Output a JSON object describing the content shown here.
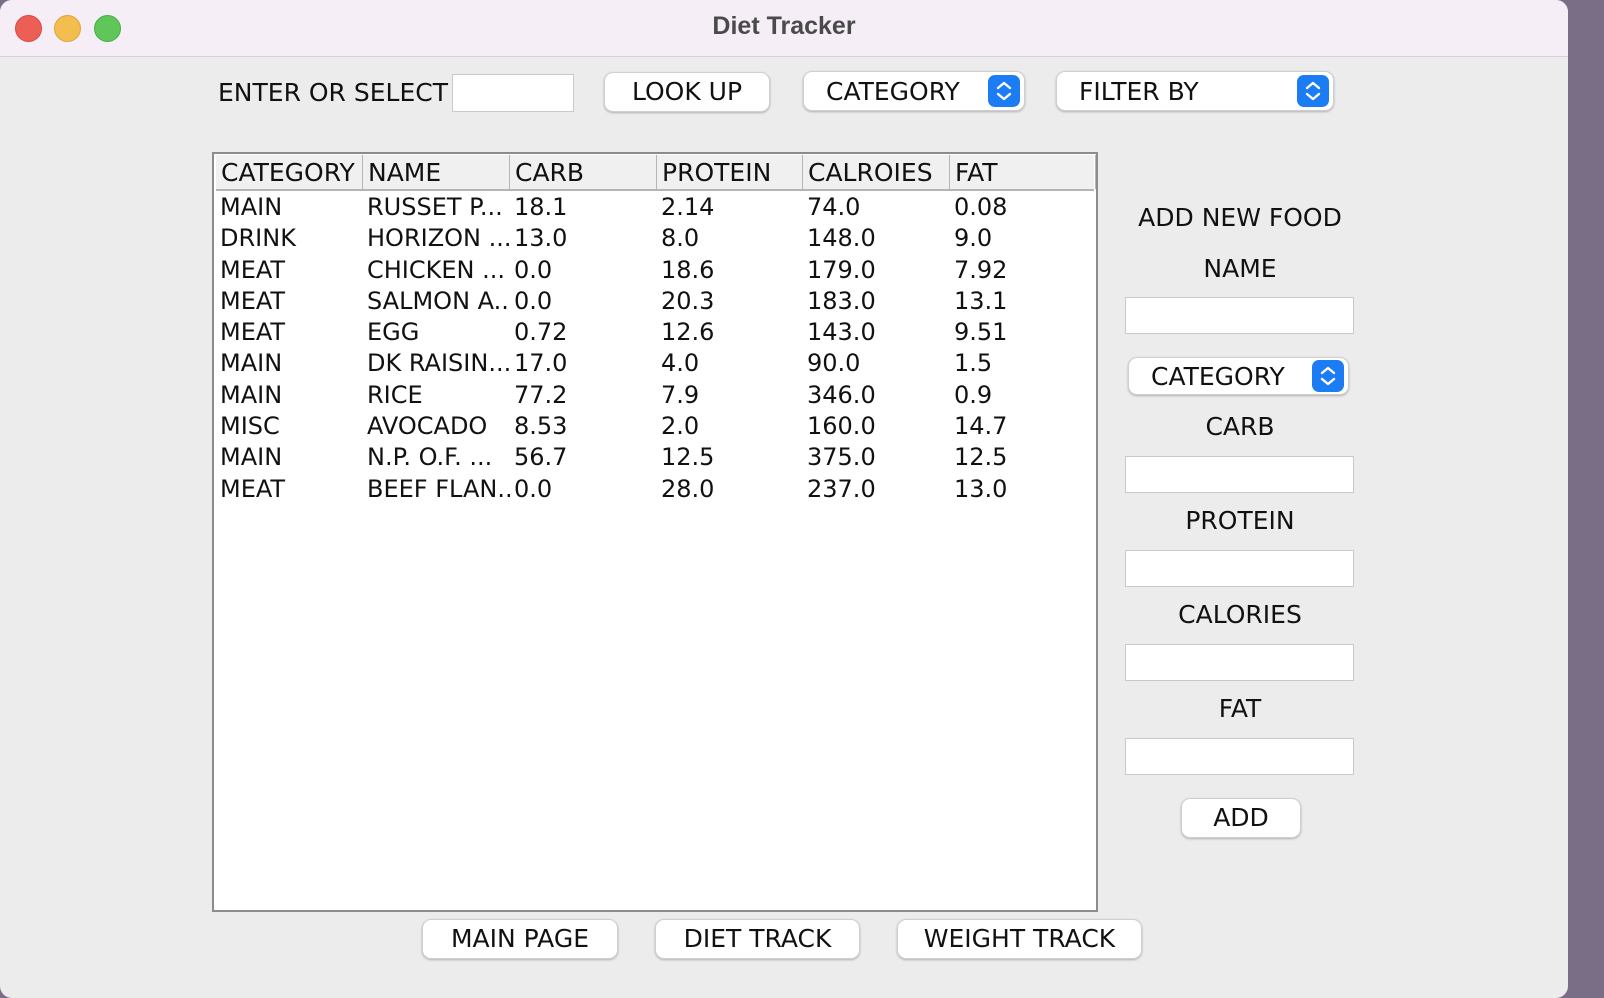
{
  "window": {
    "title": "Diet Tracker"
  },
  "search": {
    "label": "ENTER OR SELECT",
    "value": "",
    "lookup_label": "LOOK UP",
    "category_select": "CATEGORY",
    "filter_select": "FILTER BY"
  },
  "table": {
    "columns": [
      "CATEGORY",
      "NAME",
      "CARB",
      "PROTEIN",
      "CALROIES",
      "FAT"
    ],
    "rows": [
      [
        "MAIN",
        "RUSSET P...",
        "18.1",
        "2.14",
        "74.0",
        "0.08"
      ],
      [
        "DRINK",
        "HORIZON ...",
        "13.0",
        "8.0",
        "148.0",
        "9.0"
      ],
      [
        "MEAT",
        "CHICKEN ...",
        "0.0",
        "18.6",
        "179.0",
        "7.92"
      ],
      [
        "MEAT",
        "SALMON A...",
        "0.0",
        "20.3",
        "183.0",
        "13.1"
      ],
      [
        "MEAT",
        "EGG",
        "0.72",
        "12.6",
        "143.0",
        "9.51"
      ],
      [
        "MAIN",
        "DK RAISIN...",
        "17.0",
        "4.0",
        "90.0",
        "1.5"
      ],
      [
        "MAIN",
        "RICE",
        "77.2",
        "7.9",
        "346.0",
        "0.9"
      ],
      [
        "MISC",
        "AVOCADO",
        "8.53",
        "2.0",
        "160.0",
        "14.7"
      ],
      [
        "MAIN",
        "N.P. O.F. ...",
        "56.7",
        "12.5",
        "375.0",
        "12.5"
      ],
      [
        "MEAT",
        "BEEF FLAN...",
        "0.0",
        "28.0",
        "237.0",
        "13.0"
      ]
    ]
  },
  "add_food": {
    "heading": "ADD NEW FOOD",
    "name_label": "NAME",
    "name_value": "",
    "category_select": "CATEGORY",
    "carb_label": "CARB",
    "carb_value": "",
    "protein_label": "PROTEIN",
    "protein_value": "",
    "calories_label": "CALORIES",
    "calories_value": "",
    "fat_label": "FAT",
    "fat_value": "",
    "add_label": "ADD"
  },
  "nav": {
    "main_page": "MAIN PAGE",
    "diet_track": "DIET TRACK",
    "weight_track": "WEIGHT TRACK"
  },
  "colors": {
    "accent": "#1c7cf4",
    "window_bg": "#ececec"
  }
}
